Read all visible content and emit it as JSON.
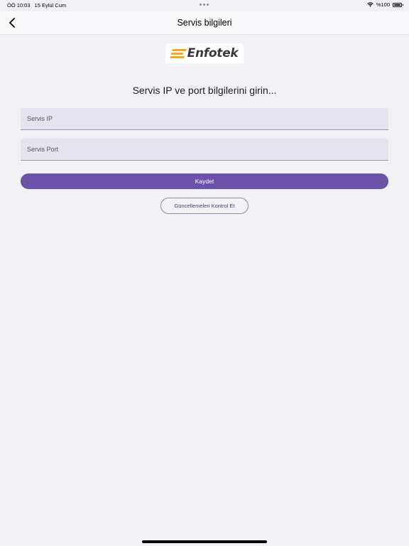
{
  "status_bar": {
    "time": "ÖÖ 10:03",
    "date": "15 Eylül Cum",
    "battery_text": "%100"
  },
  "nav": {
    "title": "Servis bilgileri",
    "back_icon": "chevron-left-icon"
  },
  "logo": {
    "text": "Enfotek",
    "accent_color": "#f5a623"
  },
  "form": {
    "headline": "Servis IP ve port bilgilerini girin...",
    "ip_placeholder": "Servis IP",
    "ip_value": "",
    "port_placeholder": "Servis Port",
    "port_value": "",
    "save_label": "Kaydet",
    "update_label": "Güncellemeleri Kontrol Et"
  },
  "colors": {
    "primary": "#6a52a8",
    "background": "#f2f1f6",
    "field_background": "#e5e3ed"
  }
}
